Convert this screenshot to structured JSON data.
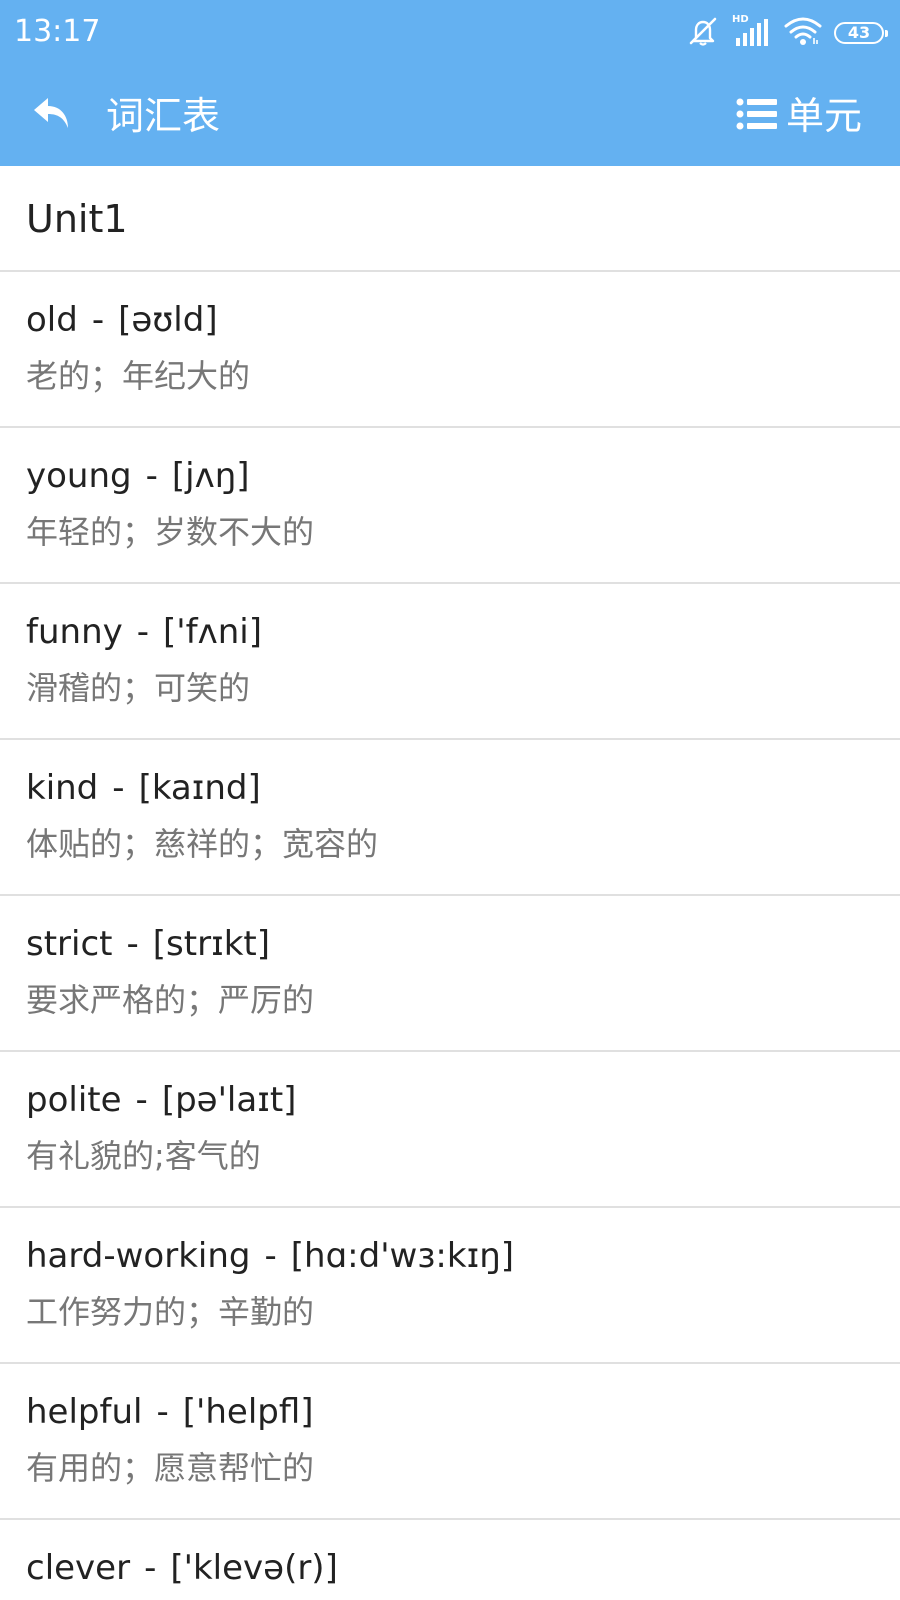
{
  "status_bar": {
    "time": "13:17",
    "hd_label": "HD",
    "battery": "43",
    "icons": [
      "bell-off-icon",
      "signal-icon",
      "wifi-icon",
      "battery-icon"
    ]
  },
  "app_bar": {
    "title": "词汇表",
    "unit_button_label": "单元",
    "icons": [
      "back-arrow-icon",
      "list-menu-icon"
    ],
    "background_color": "#64b1f1"
  },
  "unit": {
    "title": "Unit1"
  },
  "separator": "-",
  "words": [
    {
      "word": "old",
      "phonetic": "[əʊld]",
      "meaning": "老的；年纪大的"
    },
    {
      "word": "young",
      "phonetic": "[jʌŋ]",
      "meaning": "年轻的；岁数不大的"
    },
    {
      "word": "funny",
      "phonetic": "['fʌni]",
      "meaning": "滑稽的；可笑的"
    },
    {
      "word": "kind",
      "phonetic": "[kaɪnd]",
      "meaning": "体贴的；慈祥的；宽容的"
    },
    {
      "word": "strict",
      "phonetic": "[strɪkt]",
      "meaning": "要求严格的；严厉的"
    },
    {
      "word": "polite",
      "phonetic": "[pə'laɪt]",
      "meaning": "有礼貌的;客气的"
    },
    {
      "word": "hard-working",
      "phonetic": "[hɑ:d'wɜ:kɪŋ]",
      "meaning": "工作努力的；辛勤的"
    },
    {
      "word": "helpful",
      "phonetic": "['helpfl]",
      "meaning": "有用的；愿意帮忙的"
    },
    {
      "word": "clever",
      "phonetic": "['klevə(r)]",
      "meaning": ""
    }
  ]
}
